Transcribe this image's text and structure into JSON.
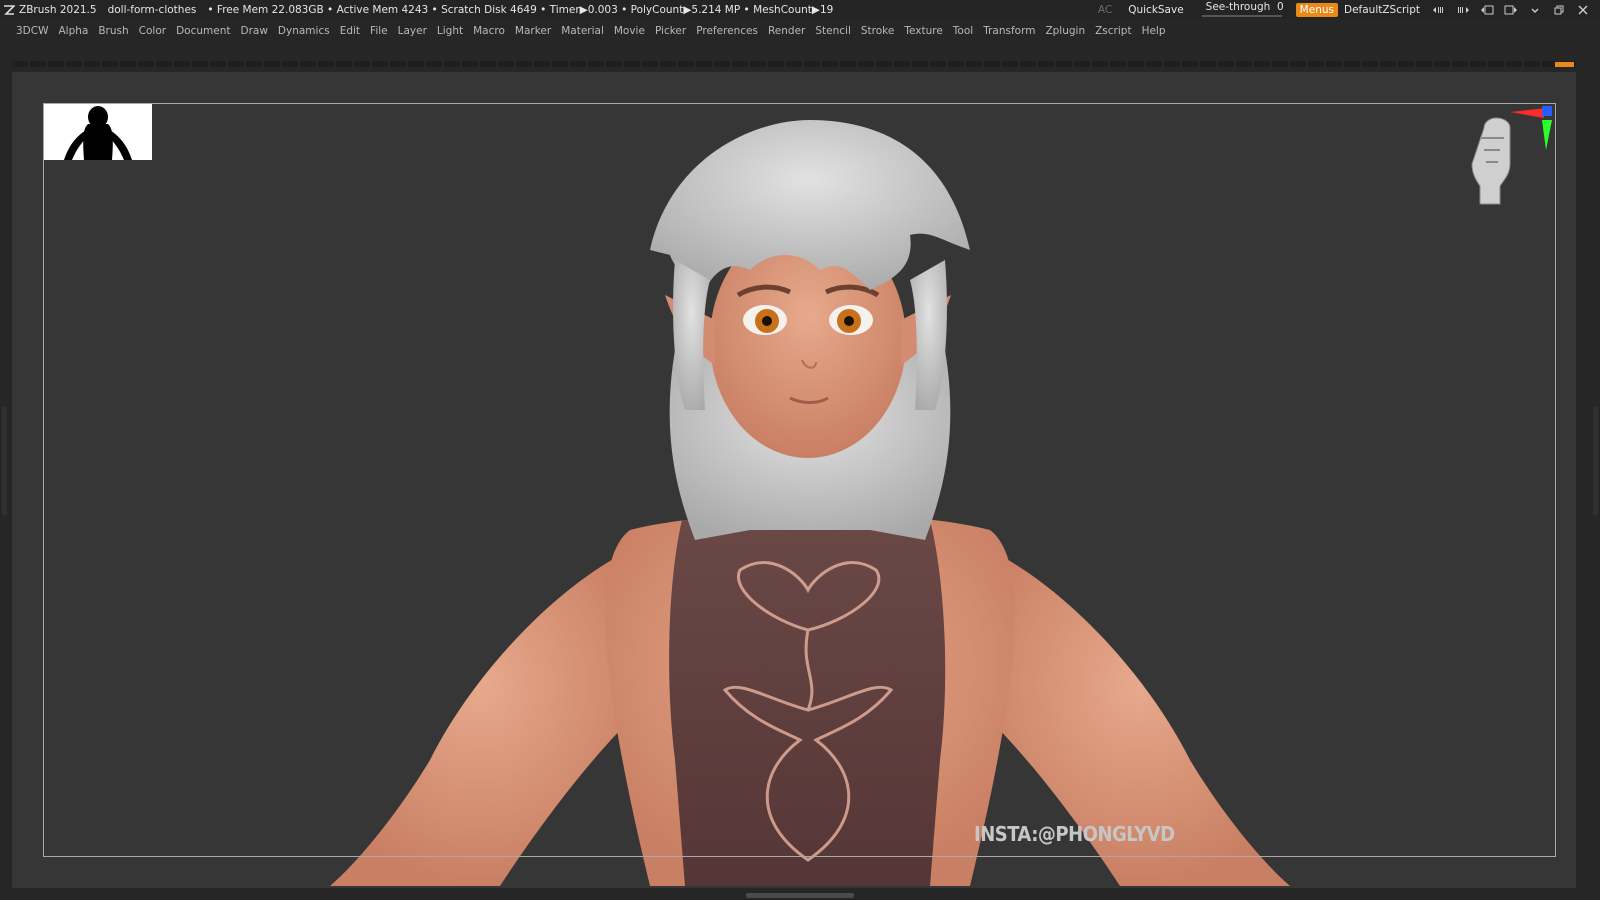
{
  "titlebar": {
    "app": "ZBrush 2021.5",
    "document": "doll-form-clothes",
    "stats": "• Free Mem 22.083GB • Active Mem 4243 • Scratch Disk 4649 •  Timer▶0.003 • PolyCount▶5.214 MP  • MeshCount▶19",
    "ac": "AC",
    "quicksave": "QuickSave",
    "seethrough_label": "See-through",
    "seethrough_value": "0",
    "seethrough_fraction": 0,
    "menus": "Menus",
    "default_zscript": "DefaultZScript"
  },
  "menubar": {
    "items": [
      "3DCW",
      "Alpha",
      "Brush",
      "Color",
      "Document",
      "Draw",
      "Dynamics",
      "Edit",
      "File",
      "Layer",
      "Light",
      "Macro",
      "Marker",
      "Material",
      "Movie",
      "Picker",
      "Preferences",
      "Render",
      "Stencil",
      "Stroke",
      "Texture",
      "Tool",
      "Transform",
      "Zplugin",
      "Zscript",
      "Help"
    ]
  },
  "canvas": {
    "watermark": "INSTA:@PHONGLYVD"
  },
  "colors": {
    "accent": "#e8891a",
    "background": "#363636",
    "hair": "#d2d2d2",
    "skin": "#d9957a",
    "top": "#5e3f3f"
  },
  "icons": [
    "zbrush-logo-icon",
    "minimize-icon",
    "restore-icon",
    "close-icon",
    "gizmo-head-icon",
    "axis-icon"
  ]
}
